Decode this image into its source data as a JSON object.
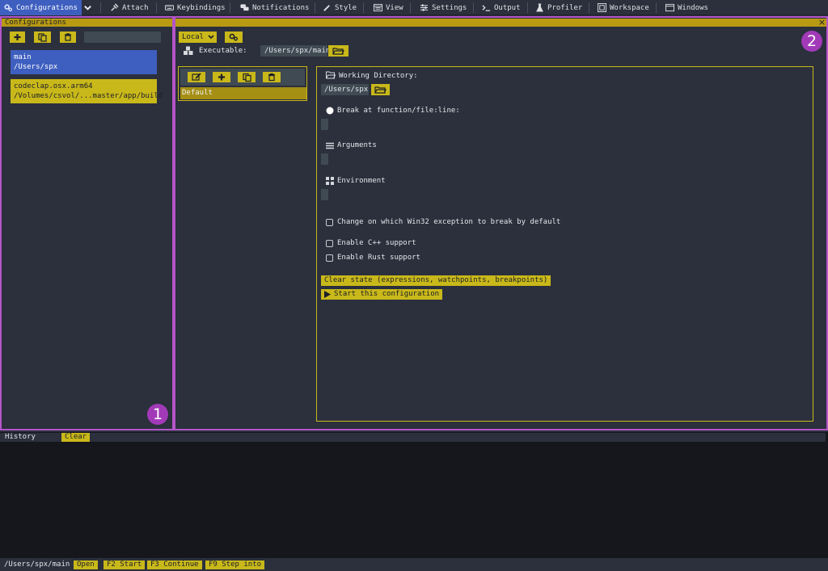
{
  "menu": {
    "items": [
      {
        "label": "Configurations",
        "icon": "gears-icon",
        "active": true
      },
      {
        "label": "Attach",
        "icon": "plug-icon"
      },
      {
        "label": "Keybindings",
        "icon": "keyboard-icon"
      },
      {
        "label": "Notifications",
        "icon": "chat-icon"
      },
      {
        "label": "Style",
        "icon": "pen-icon"
      },
      {
        "label": "View",
        "icon": "window-icon"
      },
      {
        "label": "Settings",
        "icon": "sliders-icon"
      },
      {
        "label": "Output",
        "icon": "terminal-icon"
      },
      {
        "label": "Profiler",
        "icon": "flask-icon"
      },
      {
        "label": "Workspace",
        "icon": "workspace-icon"
      },
      {
        "label": "Windows",
        "icon": "windows-icon"
      }
    ]
  },
  "configurations": {
    "title": "Configurations",
    "items": [
      {
        "name": "main",
        "path": "/Users/spx"
      },
      {
        "name": "codeclap.osx.arm64",
        "path": "/Volumes/csvol/...master/app/build"
      }
    ],
    "badge": "1"
  },
  "editor": {
    "close_label": "×",
    "badge": "2",
    "target_select": "Local",
    "executable_label": "Executable:",
    "executable_value": "/Users/spx/main",
    "variant_default": "Default",
    "working_dir_label": "Working Directory:",
    "working_dir_value": "/Users/spx",
    "break_label": "Break at function/file:line:",
    "arguments_label": "Arguments",
    "environment_label": "Environment",
    "win32_label": "Change on which Win32 exception to break by default",
    "cpp_label": "Enable C++ support",
    "rust_label": "Enable Rust support",
    "clear_state_label": "Clear state (expressions, watchpoints, breakpoints)",
    "start_label": "Start this configuration"
  },
  "history": {
    "title": "History",
    "clear_label": "Clear"
  },
  "status": {
    "path": "/Users/spx/main",
    "buttons": [
      "Open",
      "F2 Start",
      "F3 Continue",
      "F9 Step into"
    ]
  },
  "colors": {
    "accent_blue": "#3e5fbf",
    "accent_yellow": "#c9b81a",
    "highlight_purple": "#b455c8",
    "background": "#2b303c"
  }
}
